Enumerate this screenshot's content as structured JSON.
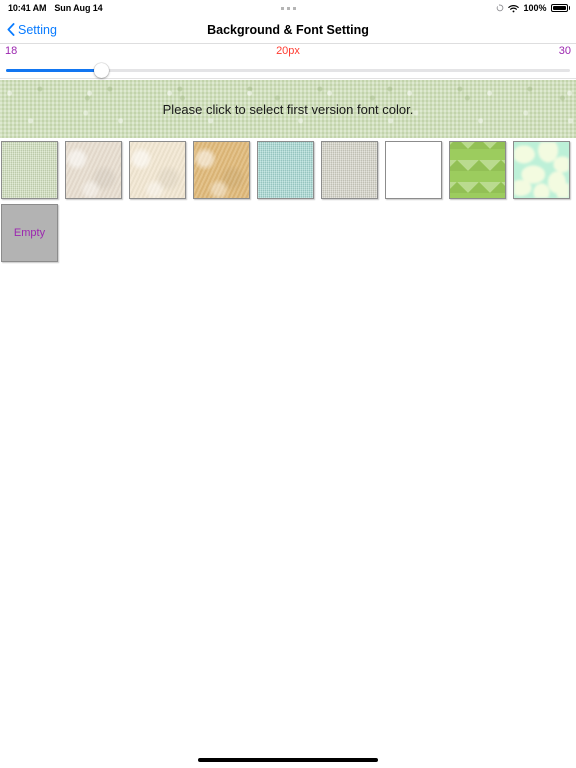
{
  "status_bar": {
    "time": "10:41 AM",
    "date": "Sun Aug 14",
    "multitask_indicator": "dots-indicator",
    "rotation_lock_icon": "rotation-lock-icon",
    "wifi_icon": "wifi-icon",
    "battery_percent": "100%",
    "battery_icon": "battery-full-icon"
  },
  "nav_bar": {
    "back_icon": "chevron-left-icon",
    "back_label": "Setting",
    "title": "Background & Font Setting",
    "back_color": "#0a7cff",
    "title_color": "#000000"
  },
  "font_size_slider": {
    "min_label": "18",
    "max_label": "30",
    "current_label": "20px",
    "min_value": 18,
    "max_value": 30,
    "current_value": 20,
    "fill_percent": 17,
    "label_color": "#9c27b0",
    "current_color": "#ff3b30",
    "fill_color": "#1276f1",
    "track_color": "#e4e4e6"
  },
  "preview": {
    "text": "Please click to select first version font color.",
    "background_color": "#cfdfbb",
    "text_color": "#1a1a1a"
  },
  "swatches": [
    {
      "name": "swatch-green-linen",
      "color": "#cfdfbb",
      "texture": "tex-noise",
      "label": ""
    },
    {
      "name": "swatch-beige-paper",
      "color": "#e8ded0",
      "texture": "tex-paper",
      "label": ""
    },
    {
      "name": "swatch-cream-paper",
      "color": "#f2e7d2",
      "texture": "tex-paper",
      "label": ""
    },
    {
      "name": "swatch-tan-parchment",
      "color": "#e0b979",
      "texture": "tex-paper",
      "label": ""
    },
    {
      "name": "swatch-teal",
      "color": "#a5d8d2",
      "texture": "tex-noise",
      "label": ""
    },
    {
      "name": "swatch-warm-gray",
      "color": "#d3d2c7",
      "texture": "tex-noise",
      "label": ""
    },
    {
      "name": "swatch-white",
      "color": "#ffffff",
      "texture": "",
      "label": ""
    },
    {
      "name": "swatch-olive-arrows",
      "color": "#9ccc5e",
      "texture": "tex-arrows",
      "label": ""
    },
    {
      "name": "swatch-mint-camo",
      "color": "#bdf0d8",
      "texture": "tex-blobs",
      "label": ""
    },
    {
      "name": "swatch-empty",
      "color": "#b3b3b3",
      "texture": "",
      "label": "Empty"
    }
  ],
  "empty_label_color": "#9c27b0",
  "home_indicator": "home-indicator"
}
